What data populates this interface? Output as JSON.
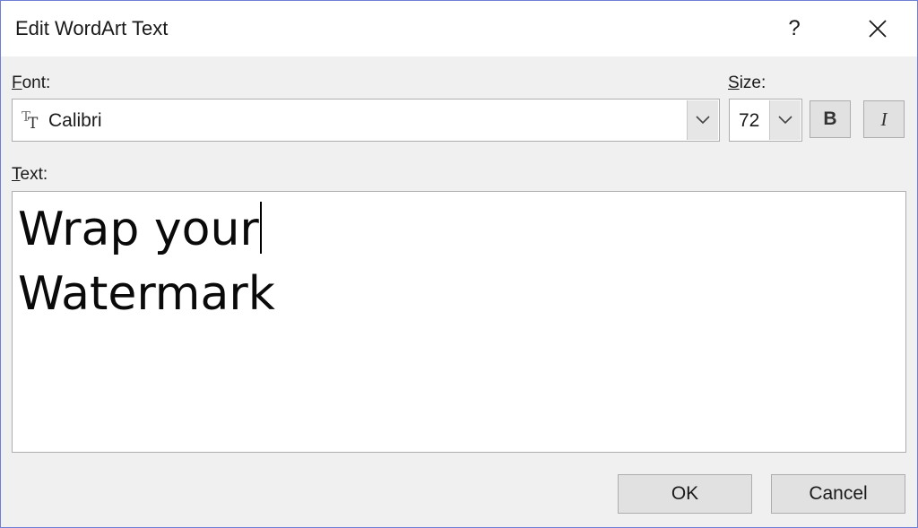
{
  "dialog": {
    "title": "Edit WordArt Text",
    "help_label": "?",
    "close_icon": "close-icon"
  },
  "font": {
    "label_accel": "F",
    "label_rest": "ont:",
    "value": "Calibri",
    "icon": "truetype-font-icon"
  },
  "size": {
    "label_accel": "S",
    "label_rest": "ize:",
    "value": "72"
  },
  "format": {
    "bold_label": "B",
    "italic_label": "I"
  },
  "text": {
    "label_accel": "T",
    "label_rest": "ext:",
    "lines": [
      "Wrap your",
      "Watermark"
    ]
  },
  "buttons": {
    "ok_label": "OK",
    "cancel_label": "Cancel"
  },
  "colors": {
    "border": "#6f7fd6",
    "dialog_bg": "#f0f0f0",
    "button_bg": "#e1e1e1"
  }
}
